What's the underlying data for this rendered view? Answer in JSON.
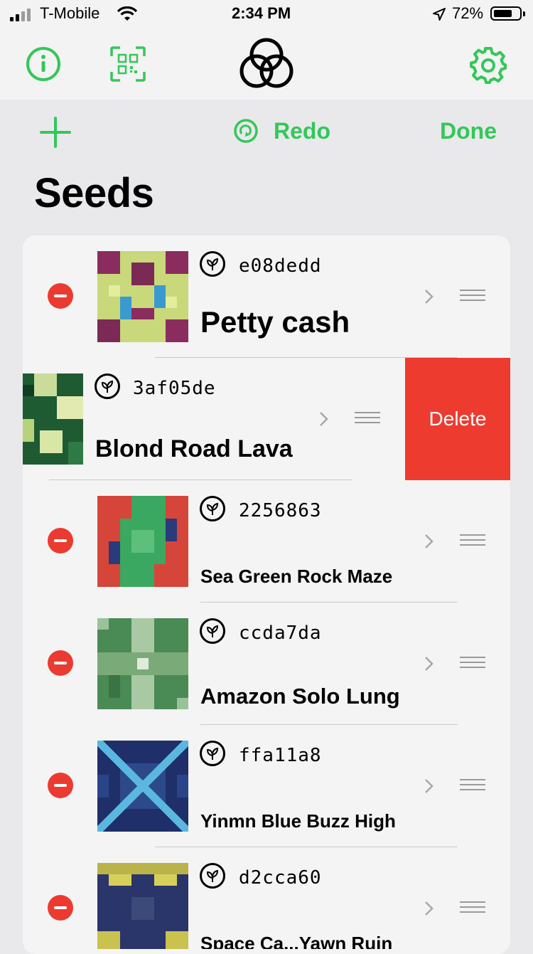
{
  "status_bar": {
    "carrier": "T-Mobile",
    "time": "2:34 PM",
    "battery": "72%"
  },
  "toolbar": {
    "redo_label": "Redo",
    "done_label": "Done"
  },
  "page": {
    "title": "Seeds"
  },
  "seeds": [
    {
      "hash": "e08dedd",
      "name": "Petty cash"
    },
    {
      "hash": "3af05de",
      "name": "Blond Road Lava"
    },
    {
      "hash": "2256863",
      "name": "Sea Green Rock Maze"
    },
    {
      "hash": "ccda7da",
      "name": "Amazon Solo Lung"
    },
    {
      "hash": "ffa11a8",
      "name": "Yinmn Blue Buzz High"
    },
    {
      "hash": "d2cca60",
      "name": "Space Ca...Yawn Ruin"
    }
  ],
  "row_action": {
    "delete_label": "Delete"
  },
  "colors": {
    "accent": "#34c759",
    "destructive": "#ee3b30",
    "background": "#e9e9ec",
    "card": "#f4f4f4"
  },
  "icons": [
    "info-icon",
    "qr-code-icon",
    "logo-icon",
    "gear-icon",
    "plus-icon",
    "redo-icon",
    "leaf-icon",
    "chevron-right-icon",
    "reorder-icon"
  ]
}
